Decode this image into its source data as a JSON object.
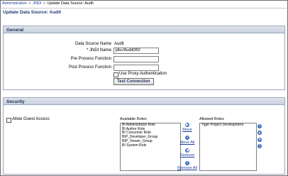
{
  "breadcrumb": {
    "items": [
      "Administration",
      "JNDI",
      "Update Data Source: Audit"
    ],
    "separator": ">"
  },
  "page_title": "Update Data Source: Audit",
  "general": {
    "header": "General",
    "data_source_name_label": "Data Source Name",
    "data_source_name_value": "Audit",
    "jndi_name_label": "* JNDI Name",
    "jndi_name_value": "jdbc/AuditDB2",
    "pre_process_label": "Pre Process Function",
    "pre_process_value": "",
    "post_process_label": "Post Process Function",
    "post_process_value": "",
    "use_proxy_label": "Use Proxy Authentication",
    "use_proxy_checked": false,
    "test_connection_label": "Test Connection"
  },
  "security": {
    "header": "Security",
    "allow_guest_label": "Allow Guest Access",
    "allow_guest_checked": false,
    "available_roles_label": "Available Roles",
    "available_roles": [
      "BI Administrator Role",
      "BI Author Role",
      "BI Consumer Role",
      "BIP_Developer_Group",
      "BIP_Viewer_Group",
      "BI System Role"
    ],
    "allowed_roles_label": "Allowed Roles",
    "allowed_roles": [
      "Tiger Project Development"
    ],
    "shuttle": {
      "move": "Move",
      "move_all": "Move All",
      "remove": "Remove",
      "remove_all": "Remove All"
    }
  },
  "colors": {
    "link": "#1a3f9c",
    "panel_header": "#c7d0dd",
    "title": "#1f3a78",
    "shuttle_icon": "#3b6fc4"
  },
  "icons": {
    "move": "arrow-right-icon",
    "move_all": "double-arrow-right-icon",
    "remove": "arrow-left-icon",
    "remove_all": "double-arrow-left-icon",
    "reorder": [
      "move-top-icon",
      "move-up-icon",
      "move-down-icon",
      "move-bottom-icon"
    ]
  }
}
